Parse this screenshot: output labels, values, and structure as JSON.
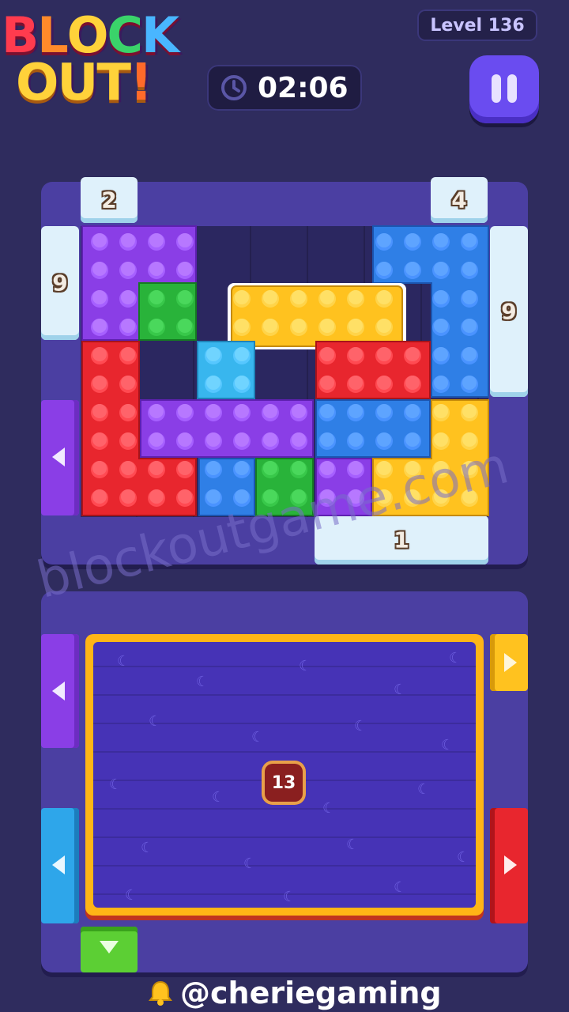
{
  "logo": {
    "line1": [
      "B",
      "L",
      "O",
      "C",
      "K"
    ],
    "line2": [
      "O",
      "U",
      "T",
      "!"
    ],
    "colors1": [
      "#ff3b4e",
      "#ff8a2a",
      "#ffd23a",
      "#3ad36a",
      "#49b6ff"
    ],
    "colors2": [
      "#ffd23a",
      "#ffd23a",
      "#ffd23a",
      "#ff6a2a"
    ]
  },
  "level": {
    "label": "Level 136"
  },
  "timer": {
    "value": "02:06",
    "icon": "clock-icon"
  },
  "pause": {
    "icon": "pause-icon"
  },
  "board1": {
    "gates": {
      "top_left": "2",
      "top_right": "4",
      "left": "9",
      "right": "9",
      "bottom": "1"
    }
  },
  "board2": {
    "counter": "13"
  },
  "watermark": "blockoutgame.com",
  "credit": {
    "handle": "@cheriegaming",
    "icon": "bell-icon"
  },
  "colors": {
    "purple": "#8a3ee6",
    "green": "#29b33a",
    "yellow": "#ffc21f",
    "red": "#e8262e",
    "blue": "#2f7fe6",
    "lightblue": "#38b6ee"
  }
}
